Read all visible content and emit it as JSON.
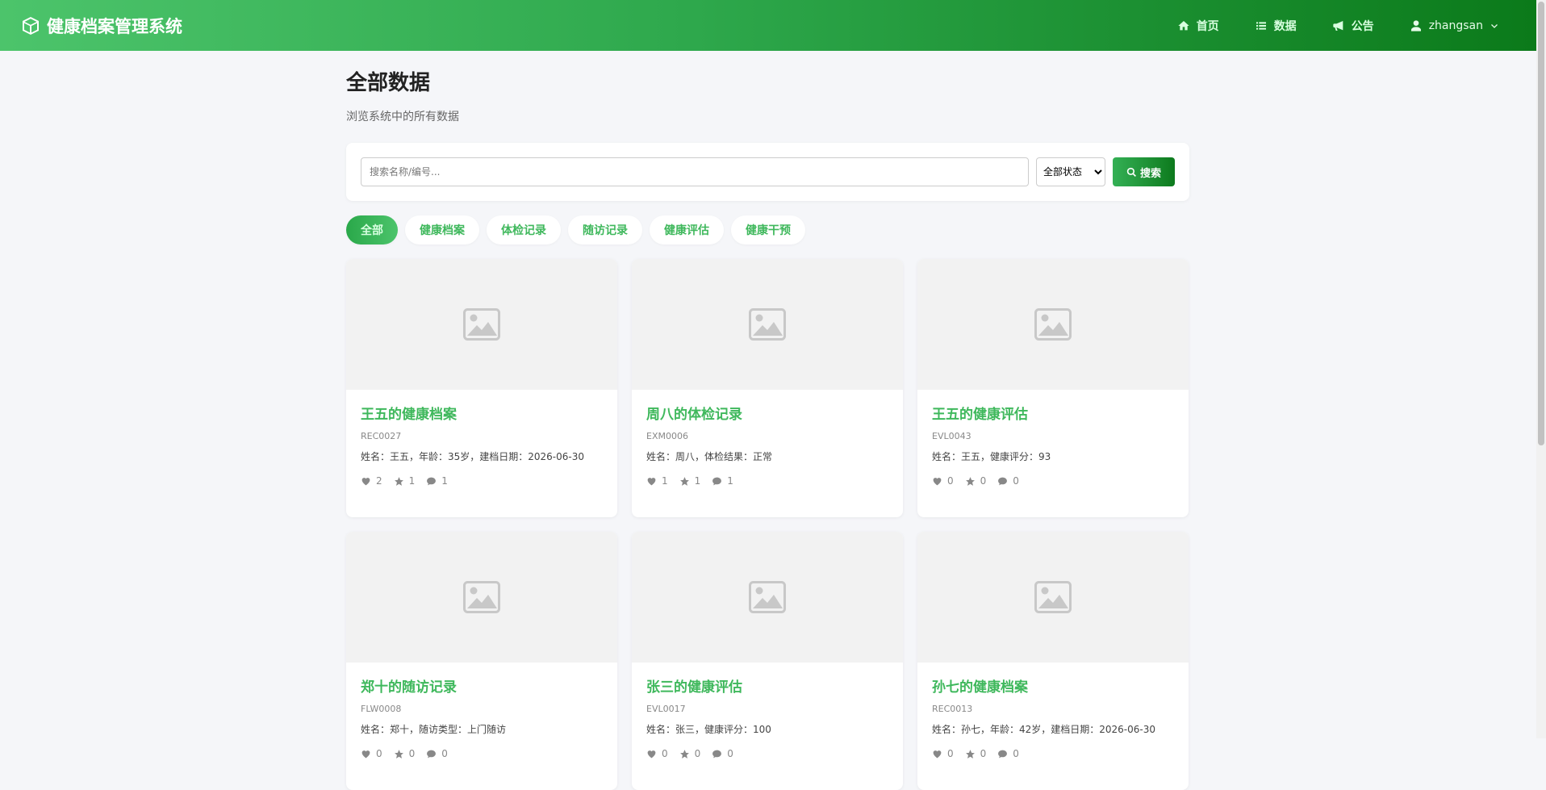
{
  "header": {
    "brand": "健康档案管理系统",
    "nav": [
      {
        "label": "首页",
        "icon": "home-icon"
      },
      {
        "label": "数据",
        "icon": "list-icon"
      },
      {
        "label": "公告",
        "icon": "bullhorn-icon"
      }
    ],
    "user": "zhangsan"
  },
  "page": {
    "title": "全部数据",
    "subtitle": "浏览系统中的所有数据"
  },
  "search": {
    "placeholder": "搜索名称/编号...",
    "value": "",
    "status_selected": "全部状态",
    "button_label": "搜索"
  },
  "tabs": [
    {
      "label": "全部",
      "active": true
    },
    {
      "label": "健康档案",
      "active": false
    },
    {
      "label": "体检记录",
      "active": false
    },
    {
      "label": "随访记录",
      "active": false
    },
    {
      "label": "健康评估",
      "active": false
    },
    {
      "label": "健康干预",
      "active": false
    }
  ],
  "cards": [
    {
      "title": "王五的健康档案",
      "code": "REC0027",
      "desc": "姓名：王五，年龄：35岁，建档日期：2026-06-30",
      "likes": "2",
      "stars": "1",
      "comments": "1"
    },
    {
      "title": "周八的体检记录",
      "code": "EXM0006",
      "desc": "姓名：周八，体检结果：正常",
      "likes": "1",
      "stars": "1",
      "comments": "1"
    },
    {
      "title": "王五的健康评估",
      "code": "EVL0043",
      "desc": "姓名：王五，健康评分：93",
      "likes": "0",
      "stars": "0",
      "comments": "0"
    },
    {
      "title": "郑十的随访记录",
      "code": "FLW0008",
      "desc": "姓名：郑十，随访类型：上门随访",
      "likes": "0",
      "stars": "0",
      "comments": "0"
    },
    {
      "title": "张三的健康评估",
      "code": "EVL0017",
      "desc": "姓名：张三，健康评分：100",
      "likes": "0",
      "stars": "0",
      "comments": "0"
    },
    {
      "title": "孙七的健康档案",
      "code": "REC0013",
      "desc": "姓名：孙七，年龄：42岁，建档日期：2026-06-30",
      "likes": "0",
      "stars": "0",
      "comments": "0"
    }
  ],
  "colors": {
    "brand_green": "#3fb85c",
    "header_dark": "#0b7a1a"
  }
}
